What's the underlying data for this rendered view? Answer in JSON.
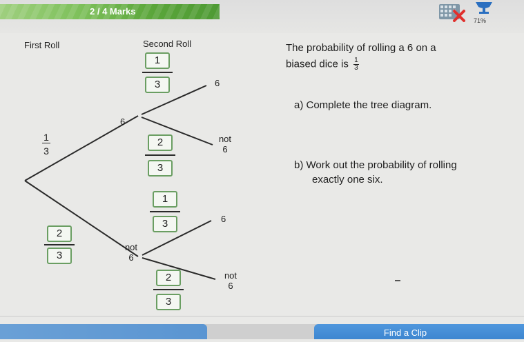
{
  "header": {
    "marks_text": "2 / 4 Marks",
    "progress_percent_text": "71%",
    "grid_icon": "grid-icon",
    "trophy_icon": "trophy-icon",
    "incorrect_icon": "cross-icon"
  },
  "tree": {
    "first_roll_header": "First Roll",
    "second_roll_header": "Second Roll",
    "first": {
      "six_label": "6",
      "six_prob_num": "1",
      "six_prob_den": "3",
      "not_six_label_line1": "not",
      "not_six_label_line2": "6",
      "not_six_answer_num": "2",
      "not_six_answer_den": "3"
    },
    "after_six": {
      "six_label": "6",
      "six_answer_num": "1",
      "six_answer_den": "3",
      "not_six_label_line1": "not",
      "not_six_label_line2": "6",
      "not_six_answer_num": "2",
      "not_six_answer_den": "3"
    },
    "after_not_six": {
      "six_label": "6",
      "six_answer_num": "1",
      "six_answer_den": "3",
      "not_six_label_line1": "not",
      "not_six_label_line2": "6",
      "not_six_answer_num": "2",
      "not_six_answer_den": "3"
    }
  },
  "question": {
    "intro_line1": "The probability of rolling a 6 on a",
    "intro_line2": "biased dice is",
    "intro_frac_num": "1",
    "intro_frac_den": "3",
    "part_a": "a)  Complete the tree diagram.",
    "part_b_line1": "b)  Work out the probability of rolling",
    "part_b_line2": "exactly one six."
  },
  "footer": {
    "find_clip_label": "Find a Clip"
  },
  "colors": {
    "marks_bar": "#5aa53a",
    "answer_box_border": "#6a9e62",
    "find_clip_button": "#3d86d0"
  }
}
